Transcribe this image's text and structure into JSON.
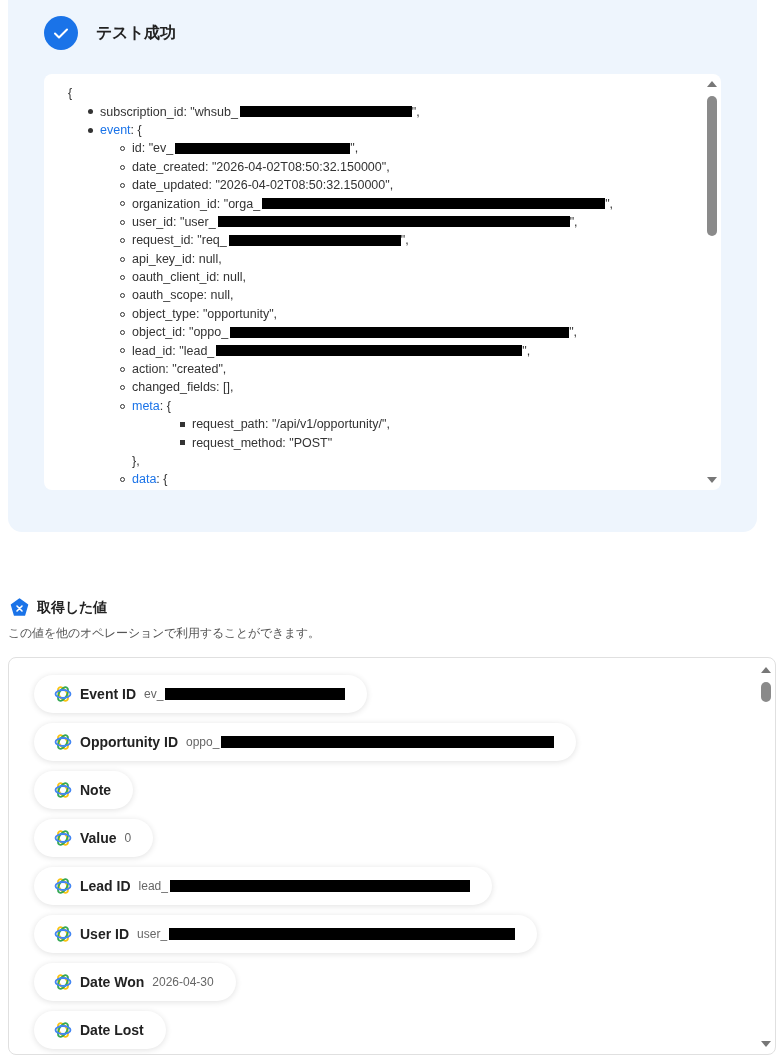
{
  "test_result": {
    "title": "テスト成功",
    "success": true,
    "json_view": {
      "open": "{",
      "items": [
        {
          "kind": "field",
          "text": "subscription_id: \"whsub_",
          "redacted": true,
          "after": "\","
        },
        {
          "kind": "object",
          "key": "event",
          "open": ": {",
          "children": [
            {
              "kind": "field",
              "text": "id: \"ev_",
              "redacted": true,
              "after": "\","
            },
            {
              "kind": "field",
              "text": "date_created: \"2026-04-02T08:50:32.150000\",",
              "redacted": false
            },
            {
              "kind": "field",
              "text": "date_updated: \"2026-04-02T08:50:32.150000\",",
              "redacted": false
            },
            {
              "kind": "field",
              "text": "organization_id: \"orga_",
              "redacted": true,
              "after": "\","
            },
            {
              "kind": "field",
              "text": "user_id: \"user_",
              "redacted": true,
              "after": "\","
            },
            {
              "kind": "field",
              "text": "request_id: \"req_",
              "redacted": true,
              "after": "\","
            },
            {
              "kind": "field",
              "text": "api_key_id: null,",
              "redacted": false
            },
            {
              "kind": "field",
              "text": "oauth_client_id: null,",
              "redacted": false
            },
            {
              "kind": "field",
              "text": "oauth_scope: null,",
              "redacted": false
            },
            {
              "kind": "field",
              "text": "object_type: \"opportunity\",",
              "redacted": false
            },
            {
              "kind": "field",
              "text": "object_id: \"oppo_",
              "redacted": true,
              "after": "\","
            },
            {
              "kind": "field",
              "text": "lead_id: \"lead_",
              "redacted": true,
              "after": "\","
            },
            {
              "kind": "field",
              "text": "action: \"created\",",
              "redacted": false
            },
            {
              "kind": "field",
              "text": "changed_fields: [],",
              "redacted": false
            },
            {
              "kind": "object",
              "key": "meta",
              "open": ": {",
              "close": "},",
              "children": [
                {
                  "kind": "field",
                  "text": "request_path: \"/api/v1/opportunity/\",",
                  "redacted": false
                },
                {
                  "kind": "field",
                  "text": "request_method: \"POST\"",
                  "redacted": false
                }
              ]
            },
            {
              "kind": "object",
              "key": "data",
              "open": ": {"
            }
          ]
        }
      ]
    }
  },
  "obtained_values": {
    "title": "取得した値",
    "description": "この値を他のオペレーションで利用することができます。",
    "items": [
      {
        "label": "Event ID",
        "value": "ev_",
        "redacted": true
      },
      {
        "label": "Opportunity ID",
        "value": "oppo_",
        "redacted": true
      },
      {
        "label": "Note",
        "redacted": false
      },
      {
        "label": "Value",
        "value": "0",
        "redacted": false
      },
      {
        "label": "Lead ID",
        "value": "lead_",
        "redacted": true
      },
      {
        "label": "User ID",
        "value": "user_",
        "redacted": true
      },
      {
        "label": "Date Won",
        "value": "2026-04-30",
        "redacted": false
      },
      {
        "label": "Date Lost",
        "redacted": false
      }
    ]
  }
}
